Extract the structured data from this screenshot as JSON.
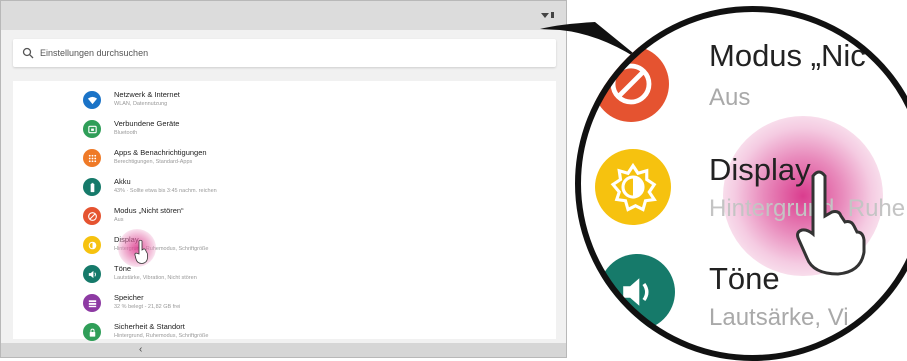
{
  "search": {
    "placeholder": "Einstellungen durchsuchen"
  },
  "settings": [
    {
      "title": "Netzwerk & Internet",
      "subtitle": "WLAN, Datennutzung",
      "icon": "network-icon",
      "color": "#1a73c7"
    },
    {
      "title": "Verbundene Geräte",
      "subtitle": "Bluetooth",
      "icon": "devices-icon",
      "color": "#2f9e58"
    },
    {
      "title": "Apps & Benachrichtigungen",
      "subtitle": "Berechtigungen, Standard-Apps",
      "icon": "apps-icon",
      "color": "#ef7a27"
    },
    {
      "title": "Akku",
      "subtitle": "43% · Sollte etwa bis 3:45 nachm. reichen",
      "icon": "battery-icon",
      "color": "#167a6a"
    },
    {
      "title": "Modus „Nicht stören“",
      "subtitle": "Aus",
      "icon": "dnd-icon",
      "color": "#e55330"
    },
    {
      "title": "Display",
      "subtitle": "Hintergrund, Ruhemodus, Schriftgröße",
      "icon": "display-icon",
      "color": "#f6c20f"
    },
    {
      "title": "Töne",
      "subtitle": "Lautstärke, Vibration, Nicht stören",
      "icon": "sound-icon",
      "color": "#167a6a"
    },
    {
      "title": "Speicher",
      "subtitle": "32 % belegt - 21,82 GB frei",
      "icon": "storage-icon",
      "color": "#8d3aa3"
    },
    {
      "title": "Sicherheit & Standort",
      "subtitle": "Hintergrund, Ruhemodus, Schriftgröße",
      "icon": "lock-icon",
      "color": "#2f9e58"
    }
  ],
  "zoom": {
    "dnd_title": "Modus „Nic",
    "dnd_sub": "Aus",
    "display_title": "Display",
    "display_sub": "Hintergrund, Ruhe",
    "sound_title": "Töne",
    "sound_sub": "Lautsärke, Vi"
  },
  "navbar": {
    "back_glyph": "‹"
  }
}
